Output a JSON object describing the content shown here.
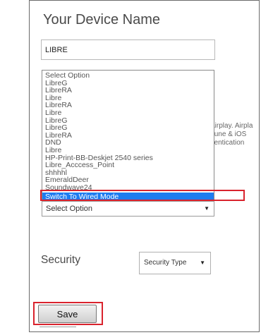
{
  "device_name_section": {
    "title": "Your Device Name",
    "name_value": "LIBRE"
  },
  "background_text": {
    "line1": "Airplay. Airpla",
    "line2": "Tune & iOS",
    "line3": "hentication"
  },
  "network_list": {
    "options": [
      "Select Option",
      "LibreG",
      "LibreRA",
      "Libre",
      "LibreRA",
      "Libre",
      "LibreG",
      "LibreG",
      "LibreRA",
      "DND",
      "Libre",
      "HP-Print-BB-Deskjet 2540 series",
      "Libre_Acccess_Point",
      "shhhhl",
      "EmeraldDeer",
      "Soundwave24"
    ],
    "selected_option": "Switch To Wired Mode"
  },
  "network_select": {
    "value": "Select Option"
  },
  "security": {
    "label": "Security",
    "type_value": "Security Type"
  },
  "actions": {
    "save_label": "Save"
  },
  "colors": {
    "highlight_border": "#d9232d",
    "selected_option_bg": "#1e7cf0"
  }
}
